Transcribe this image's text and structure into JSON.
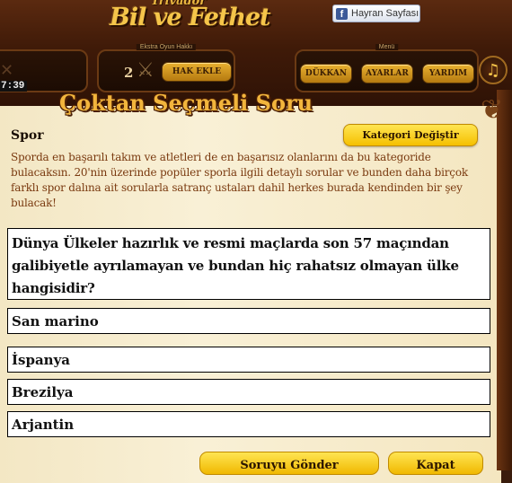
{
  "header": {
    "logo_sub": "Trivador",
    "logo": "Bil ve Fethet",
    "facebook_label": "Hayran Sayfası",
    "timer": "7:39",
    "extra_panel_title": "Ekstra Oyun Hakkı",
    "extra_count": "2",
    "add_right_label": "HAK EKLE",
    "menu_panel_title": "Menü",
    "menu": [
      "DÜKKAN",
      "AYARLAR",
      "YARDIM"
    ]
  },
  "dialog": {
    "title": "Çoktan Seçmeli Soru",
    "category": "Spor",
    "change_category_label": "Kategori Değiştir",
    "description": "Sporda en başarılı takım ve atletleri de en başarısız olanlarını da bu kategoride bulacaksın. 20'nin üzerinde popüler sporla ilgili detaylı sorular ve bunden daha birçok farklı spor dalına ait sorularla satranç ustaları dahil herkes burada kendinden bir şey bulacak!",
    "question": "Dünya Ülkeler hazırlık ve resmi maçlarda son 57 maçından galibiyetle ayrılamayan ve bundan hiç rahatsız olmayan ülke hangisidir?",
    "answers": [
      "San marino",
      "İspanya",
      "Brezilya",
      "Arjantin"
    ],
    "submit_label": "Soruyu Gönder",
    "close_label": "Kapat"
  },
  "colors": {
    "frame": "#3a1c0c",
    "parchment": "#f7eccd",
    "gold_button": "#f5c000",
    "title_gold": "#f2b53c",
    "description_text": "#7a3a10"
  },
  "icons": [
    "facebook-icon",
    "crossed-swords-icon",
    "sword-icon",
    "music-note-icon",
    "corner-ornament-icon"
  ]
}
